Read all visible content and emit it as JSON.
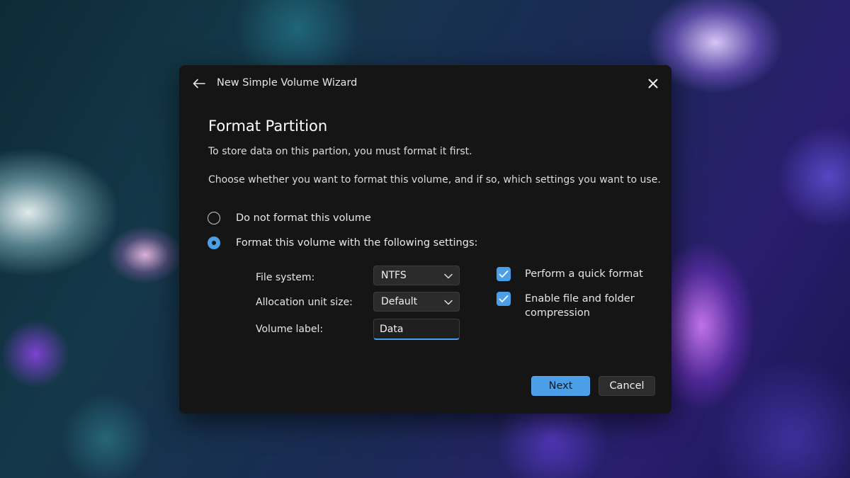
{
  "window": {
    "title": "New Simple Volume Wizard",
    "back_icon": "arrow-left-icon",
    "close_icon": "close-icon"
  },
  "page": {
    "heading": "Format Partition",
    "intro": "To store data on this partion, you must format it first.",
    "instructions": "Choose whether you want to format this volume, and if so, which settings you want to use."
  },
  "options": {
    "no_format": {
      "label": "Do not format this volume",
      "selected": false
    },
    "format": {
      "label": "Format this volume with the following settings:",
      "selected": true
    }
  },
  "settings": {
    "file_system": {
      "label": "File system:",
      "value": "NTFS"
    },
    "allocation_unit": {
      "label": "Allocation unit size:",
      "value": "Default"
    },
    "volume_label": {
      "label": "Volume label:",
      "value": "Data"
    }
  },
  "checkboxes": {
    "quick_format": {
      "label": "Perform a quick format",
      "checked": true
    },
    "compression": {
      "label": "Enable file and folder compression",
      "checked": true
    }
  },
  "buttons": {
    "next": "Next",
    "cancel": "Cancel"
  },
  "colors": {
    "accent": "#4a9fe8",
    "dialog_background": "#151515"
  }
}
